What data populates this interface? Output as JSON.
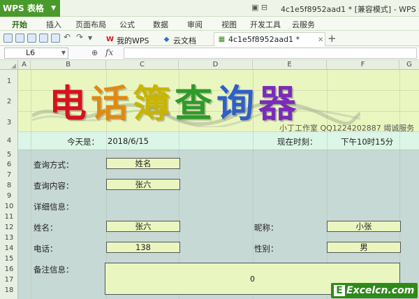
{
  "titlebar": {
    "app_name": "WPS 表格",
    "window_title": "4c1e5f8952aad1 * [兼容模式] - WPS 表格"
  },
  "menu": {
    "items": [
      "开始",
      "插入",
      "页面布局",
      "公式",
      "数据",
      "审阅",
      "视图",
      "开发工具",
      "云服务"
    ]
  },
  "tabs": {
    "items": [
      "我的WPS",
      "云文档",
      "4c1e5f8952aad1 *"
    ]
  },
  "formula": {
    "name_box": "L6",
    "fx": "fx",
    "content": ""
  },
  "columns": [
    "A",
    "B",
    "C",
    "D",
    "E",
    "F",
    "G"
  ],
  "rows": [
    "1",
    "2",
    "3",
    "4",
    "5",
    "6",
    "7",
    "8",
    "9",
    "10",
    "11",
    "12",
    "13",
    "14",
    "15",
    "16",
    "17",
    "18"
  ],
  "banner": {
    "chars": [
      "电",
      "话",
      "簿",
      "查",
      "询",
      "器"
    ],
    "colors": [
      "#d6131d",
      "#e08a12",
      "#c9b400",
      "#2f9a2a",
      "#2f5fc8",
      "#7a2cb8"
    ],
    "studio": "小丁工作室 QQ1224202887 竭诚服务"
  },
  "row4": {
    "today_label": "今天是：",
    "today_value": "2018/6/15",
    "now_label": "现在时刻：",
    "now_value": "下午10时15分"
  },
  "form": {
    "query_method_label": "查询方式：",
    "query_method_value": "姓名",
    "query_content_label": "查询内容：",
    "query_content_value": "张六",
    "detail_label": "详细信息：",
    "name_label": "姓名：",
    "name_value": "张六",
    "nickname_label": "昵称：",
    "nickname_value": "小张",
    "phone_label": "电话：",
    "phone_value": "138",
    "gender_label": "性别：",
    "gender_value": "男",
    "note_label": "备注信息：",
    "note_value": "0"
  },
  "watermark": {
    "letter": "E",
    "text": "Excelcn.com"
  }
}
